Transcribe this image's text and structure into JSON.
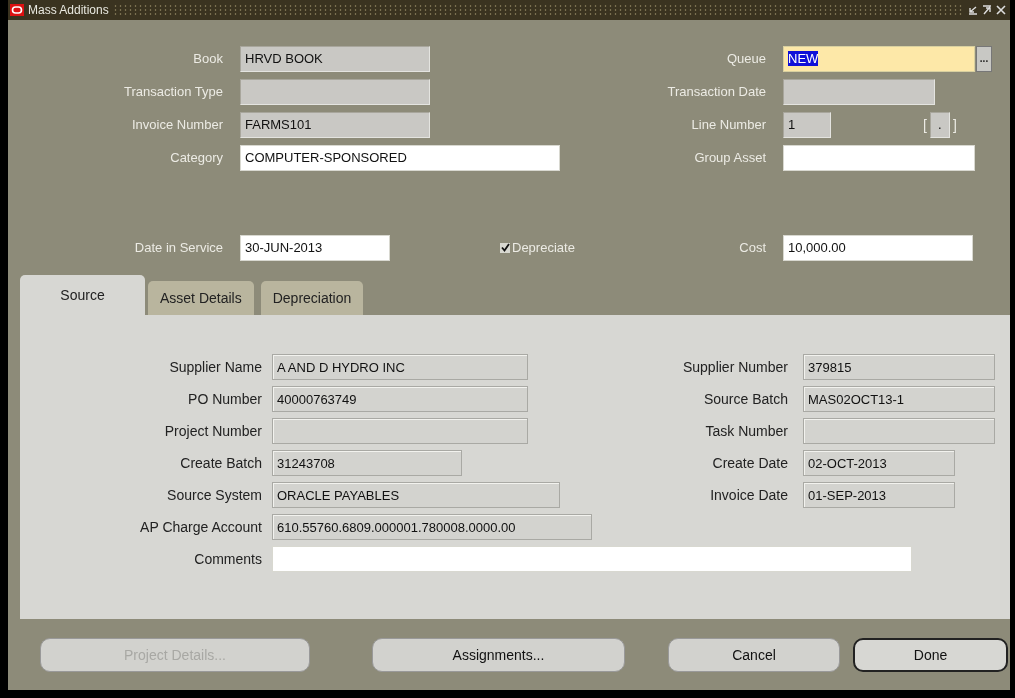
{
  "window": {
    "title": "Mass Additions"
  },
  "header": {
    "left": [
      {
        "label": "Book",
        "value": "HRVD BOOK",
        "kind": "readonly"
      },
      {
        "label": "Transaction Type",
        "kind": "readonly"
      },
      {
        "label": "Invoice Number",
        "value": "FARMS101",
        "kind": "readonly"
      },
      {
        "label": "Category",
        "value": "COMPUTER-SPONSORED",
        "kind": "editable"
      }
    ],
    "right": [
      {
        "label": "Queue",
        "value": "NEW",
        "kind": "focused",
        "text_selected": true,
        "lov_button": "..."
      },
      {
        "label": "Transaction Date",
        "kind": "readonly"
      },
      {
        "label": "Line Number",
        "value": "1",
        "kind": "readonly",
        "flexfield": {
          "open": "[",
          "value": ".",
          "close": "]"
        }
      },
      {
        "label": "Group Asset",
        "kind": "editable"
      }
    ]
  },
  "service_row": {
    "date_in_service": {
      "label": "Date in Service",
      "value": "30-JUN-2013",
      "kind": "editable"
    },
    "depreciate": {
      "label": "Depreciate",
      "checked": true
    },
    "cost": {
      "label": "Cost",
      "value": "10,000.00",
      "kind": "editable"
    }
  },
  "tabs": [
    {
      "label": "Source",
      "selected": true
    },
    {
      "label": "Asset Details",
      "selected": false
    },
    {
      "label": "Depreciation",
      "selected": false
    }
  ],
  "source": {
    "left": [
      {
        "label": "Supplier Name",
        "value": "A AND D HYDRO INC",
        "kind": "readonly"
      },
      {
        "label": "PO Number",
        "value": "40000763749",
        "kind": "readonly"
      },
      {
        "label": "Project Number",
        "kind": "readonly"
      },
      {
        "label": "Create Batch",
        "value": "31243708",
        "kind": "readonly"
      },
      {
        "label": "Source System",
        "value": "ORACLE PAYABLES",
        "kind": "readonly"
      },
      {
        "label": "AP Charge Account",
        "value": "610.55760.6809.000001.780008.0000.00",
        "kind": "readonly"
      },
      {
        "label": "Comments",
        "kind": "editable"
      }
    ],
    "right": [
      {
        "label": "Supplier Number",
        "value": "379815",
        "kind": "readonly"
      },
      {
        "label": "Source Batch",
        "value": "MAS02OCT13-1",
        "kind": "readonly"
      },
      {
        "label": "Task Number",
        "kind": "readonly"
      },
      {
        "label": "Create Date",
        "value": "02-OCT-2013",
        "kind": "readonly"
      },
      {
        "label": "Invoice Date",
        "value": "01-SEP-2013",
        "kind": "readonly"
      }
    ]
  },
  "buttons": [
    {
      "label": "Project Details...",
      "disabled": true,
      "default": false
    },
    {
      "label": "Assignments...",
      "disabled": false,
      "default": false
    },
    {
      "label": "Cancel",
      "disabled": false,
      "default": false
    },
    {
      "label": "Done",
      "disabled": false,
      "default": true
    }
  ]
}
